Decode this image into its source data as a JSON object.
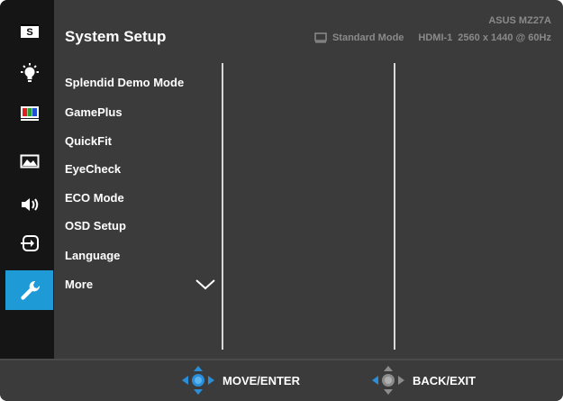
{
  "header": {
    "title": "System Setup",
    "model": "ASUS MZ27A",
    "mode": "Standard Mode",
    "input": "HDMI-1",
    "resolution": "2560 x 1440 @ 60Hz"
  },
  "sidebar": {
    "items": [
      {
        "name": "splendid",
        "icon": "splendid-s-icon",
        "label": "S"
      },
      {
        "name": "eye-care",
        "icon": "bulb-icon"
      },
      {
        "name": "color",
        "icon": "color-bars-icon"
      },
      {
        "name": "image",
        "icon": "image-icon"
      },
      {
        "name": "sound",
        "icon": "speaker-icon"
      },
      {
        "name": "input-select",
        "icon": "input-select-icon"
      },
      {
        "name": "system-setup",
        "icon": "wrench-icon",
        "active": true
      }
    ]
  },
  "menu": {
    "items": [
      "Splendid Demo Mode",
      "GamePlus",
      "QuickFit",
      "EyeCheck",
      "ECO Mode",
      "OSD Setup",
      "Language",
      "More"
    ]
  },
  "footer": {
    "move_enter": "MOVE/ENTER",
    "back_exit": "BACK/EXIT"
  },
  "colors": {
    "accent": "#1e9ad6",
    "background": "#3b3b3b",
    "rail": "#151515",
    "text": "#ffffff",
    "muted": "#8a8a8a"
  }
}
